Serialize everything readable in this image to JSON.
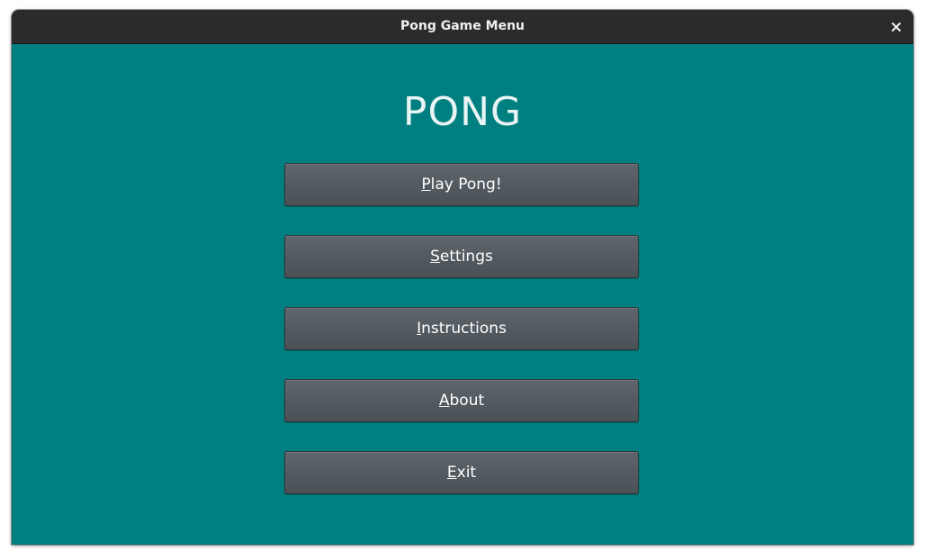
{
  "window": {
    "title": "Pong Game Menu"
  },
  "icons": {
    "close": "close-icon"
  },
  "menu": {
    "title": "PONG",
    "buttons": [
      {
        "mnemonic": "P",
        "rest": "lay Pong!"
      },
      {
        "mnemonic": "S",
        "rest": "ettings"
      },
      {
        "mnemonic": "I",
        "rest": "nstructions"
      },
      {
        "mnemonic": "A",
        "rest": "bout"
      },
      {
        "mnemonic": "E",
        "rest": "xit"
      }
    ]
  },
  "colors": {
    "background": "#007f80",
    "titlebar": "#2b2b2b",
    "button": "#555d63",
    "text": "#ffffff"
  }
}
